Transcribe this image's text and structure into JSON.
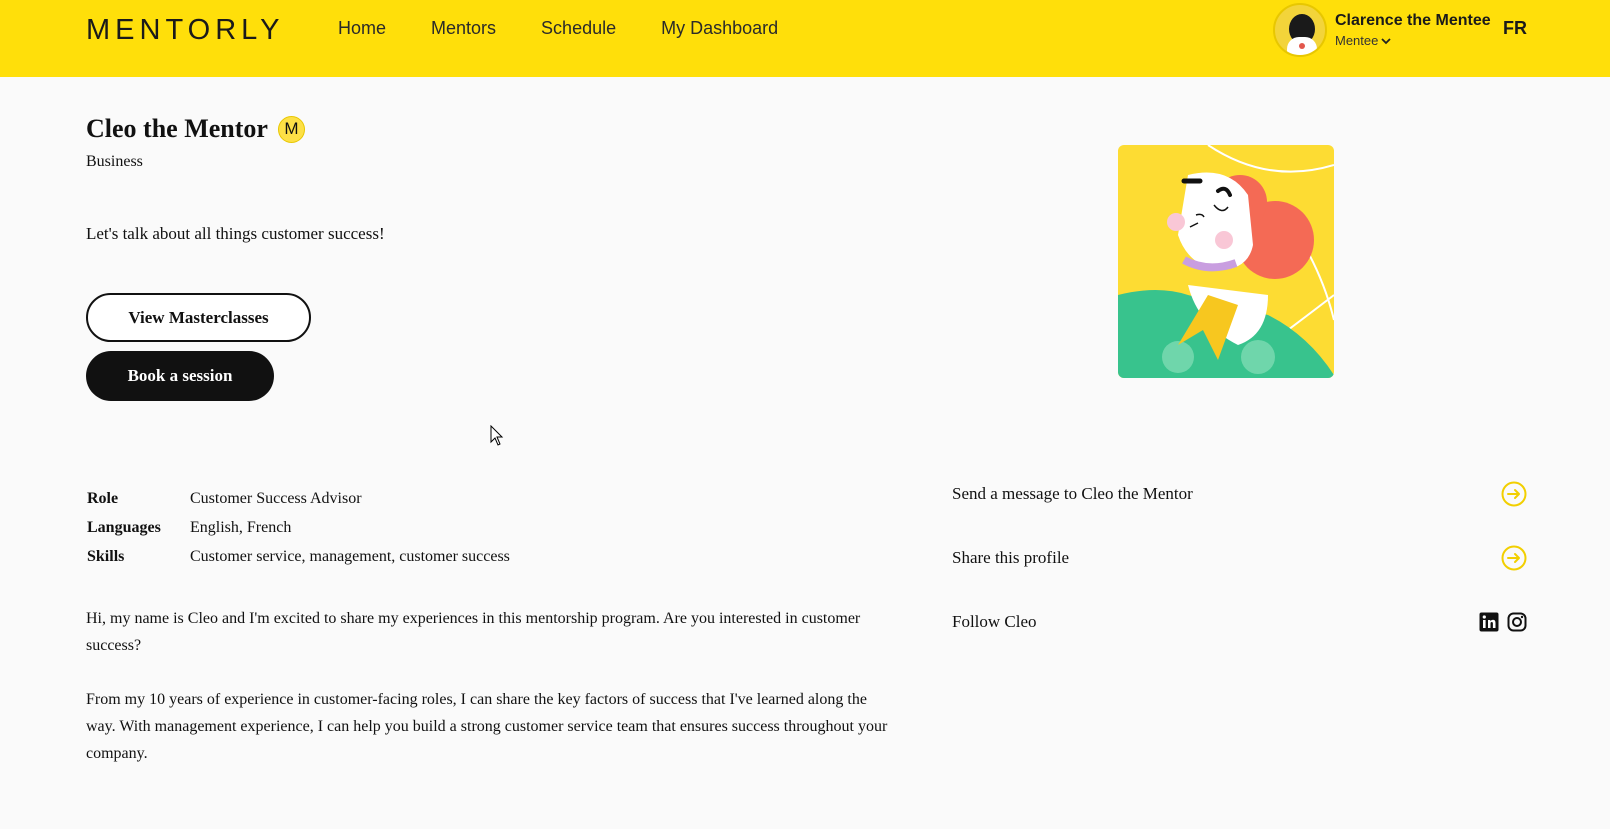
{
  "header": {
    "logo": "MENTORLY",
    "nav": [
      "Home",
      "Mentors",
      "Schedule",
      "My Dashboard"
    ],
    "user_name": "Clarence the Mentee",
    "user_role": "Mentee",
    "language": "FR"
  },
  "profile": {
    "name": "Cleo the Mentor",
    "badge": "M",
    "category": "Business",
    "tagline": "Let's talk about all things customer success!",
    "view_masterclasses_label": "View Masterclasses",
    "book_session_label": "Book a session"
  },
  "details": [
    {
      "label": "Role",
      "value": "Customer Success Advisor"
    },
    {
      "label": "Languages",
      "value": "English, French"
    },
    {
      "label": "Skills",
      "value": "Customer service, management, customer success"
    }
  ],
  "bio": [
    "Hi, my name is Cleo and I'm excited to share my experiences in this mentorship program. Are you interested in customer success?",
    "From my 10 years of experience in customer-facing roles, I can share the key factors of success that I've learned along the way. With management experience, I can help you build a strong customer service team that ensures success throughout your company."
  ],
  "actions": {
    "message": "Send a message to Cleo the Mentor",
    "share": "Share this profile",
    "follow": "Follow Cleo"
  },
  "icons": {
    "arrow": "arrow-right-circle-icon",
    "linkedin": "linkedin-icon",
    "instagram": "instagram-icon"
  },
  "colors": {
    "brand_yellow": "#ffdf0a",
    "accent_yellow": "#f2cf00",
    "button_dark": "#111111"
  }
}
